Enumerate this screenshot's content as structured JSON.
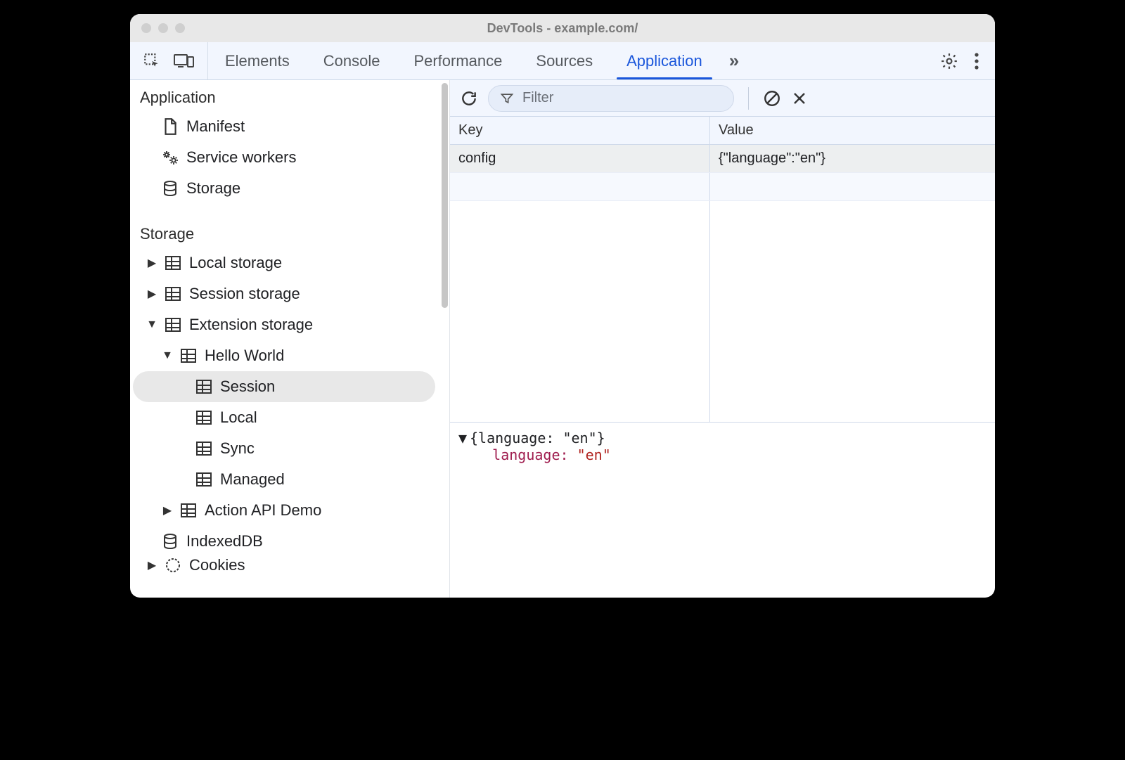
{
  "window_title": "DevTools - example.com/",
  "tabs": {
    "items": [
      "Elements",
      "Console",
      "Performance",
      "Sources",
      "Application"
    ],
    "active": "Application"
  },
  "sidebar": {
    "sections": [
      {
        "title": "Application",
        "items": [
          {
            "icon": "file",
            "label": "Manifest"
          },
          {
            "icon": "gears",
            "label": "Service workers"
          },
          {
            "icon": "db",
            "label": "Storage"
          }
        ]
      },
      {
        "title": "Storage",
        "items": [
          {
            "icon": "table",
            "label": "Local storage",
            "expandable": true,
            "expanded": false,
            "level": 0
          },
          {
            "icon": "table",
            "label": "Session storage",
            "expandable": true,
            "expanded": false,
            "level": 0
          },
          {
            "icon": "table",
            "label": "Extension storage",
            "expandable": true,
            "expanded": true,
            "level": 0
          },
          {
            "icon": "table",
            "label": "Hello World",
            "expandable": true,
            "expanded": true,
            "level": 1
          },
          {
            "icon": "table",
            "label": "Session",
            "level": 2,
            "selected": true
          },
          {
            "icon": "table",
            "label": "Local",
            "level": 2
          },
          {
            "icon": "table",
            "label": "Sync",
            "level": 2
          },
          {
            "icon": "table",
            "label": "Managed",
            "level": 2
          },
          {
            "icon": "table",
            "label": "Action API Demo",
            "expandable": true,
            "expanded": false,
            "level": 1
          },
          {
            "icon": "db",
            "label": "IndexedDB",
            "level": 0
          },
          {
            "icon": "cookie",
            "label": "Cookies",
            "expandable": true,
            "expanded": false,
            "level": 0,
            "cut": true
          }
        ]
      }
    ]
  },
  "filter": {
    "placeholder": "Filter"
  },
  "table": {
    "headers": {
      "key": "Key",
      "value": "Value"
    },
    "rows": [
      {
        "key": "config",
        "value": "{\"language\":\"en\"}"
      }
    ]
  },
  "preview": {
    "summary": "{language: \"en\"}",
    "prop": "language",
    "val": "\"en\""
  }
}
